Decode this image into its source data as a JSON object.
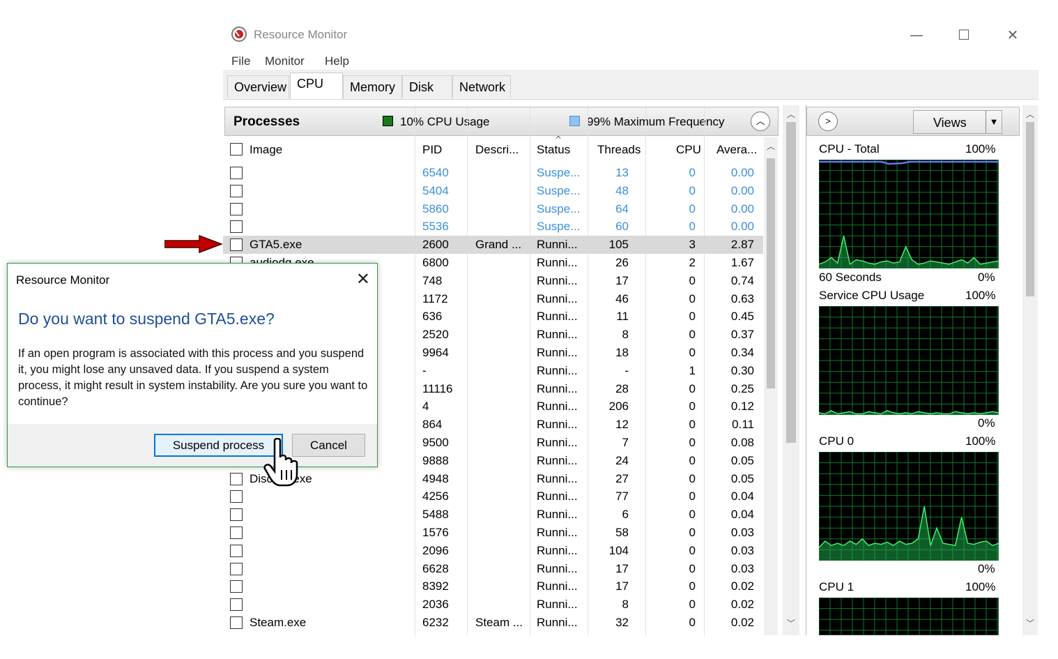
{
  "window": {
    "title": "Resource Monitor",
    "minimize_glyph": "—",
    "maximize_glyph": "☐",
    "close_glyph": "✕"
  },
  "menu": [
    "File",
    "Monitor",
    "Help"
  ],
  "tabs": [
    "Overview",
    "CPU",
    "Memory",
    "Disk",
    "Network"
  ],
  "active_tab": "CPU",
  "processes": {
    "title": "Processes",
    "cpu_usage": "10% CPU Usage",
    "max_frequency": "99% Maximum Frequency",
    "cpu_usage_color": "#1a7a1a",
    "frequency_color": "#8fc2f0",
    "columns": [
      "Image",
      "PID",
      "Descri...",
      "Status",
      "Threads",
      "CPU",
      "Avera..."
    ],
    "rows": [
      {
        "image": "",
        "pid": "6540",
        "desc": "",
        "status": "Suspe...",
        "threads": "13",
        "cpu": "0",
        "avg": "0.00",
        "suspended": true
      },
      {
        "image": "",
        "pid": "5404",
        "desc": "",
        "status": "Suspe...",
        "threads": "48",
        "cpu": "0",
        "avg": "0.00",
        "suspended": true
      },
      {
        "image": "",
        "pid": "5860",
        "desc": "",
        "status": "Suspe...",
        "threads": "64",
        "cpu": "0",
        "avg": "0.00",
        "suspended": true
      },
      {
        "image": "",
        "pid": "5536",
        "desc": "",
        "status": "Suspe...",
        "threads": "60",
        "cpu": "0",
        "avg": "0.00",
        "suspended": true
      },
      {
        "image": "GTA5.exe",
        "pid": "2600",
        "desc": "Grand ...",
        "status": "Runni...",
        "threads": "105",
        "cpu": "3",
        "avg": "2.87",
        "selected": true
      },
      {
        "image": "audiodg.exe",
        "pid": "6800",
        "desc": "",
        "status": "Runni...",
        "threads": "26",
        "cpu": "2",
        "avg": "1.67"
      },
      {
        "image": "",
        "pid": "748",
        "desc": "",
        "status": "Runni...",
        "threads": "17",
        "cpu": "0",
        "avg": "0.74"
      },
      {
        "image": "",
        "pid": "1172",
        "desc": "",
        "status": "Runni...",
        "threads": "46",
        "cpu": "0",
        "avg": "0.63"
      },
      {
        "image": "",
        "pid": "636",
        "desc": "",
        "status": "Runni...",
        "threads": "11",
        "cpu": "0",
        "avg": "0.45"
      },
      {
        "image": "",
        "pid": "2520",
        "desc": "",
        "status": "Runni...",
        "threads": "8",
        "cpu": "0",
        "avg": "0.37"
      },
      {
        "image": "",
        "pid": "9964",
        "desc": "",
        "status": "Runni...",
        "threads": "18",
        "cpu": "0",
        "avg": "0.34"
      },
      {
        "image": "",
        "pid": "-",
        "desc": "",
        "status": "Runni...",
        "threads": "-",
        "cpu": "1",
        "avg": "0.30"
      },
      {
        "image": "",
        "pid": "11116",
        "desc": "",
        "status": "Runni...",
        "threads": "28",
        "cpu": "0",
        "avg": "0.25"
      },
      {
        "image": "",
        "pid": "4",
        "desc": "",
        "status": "Runni...",
        "threads": "206",
        "cpu": "0",
        "avg": "0.12"
      },
      {
        "image": "",
        "pid": "864",
        "desc": "",
        "status": "Runni...",
        "threads": "12",
        "cpu": "0",
        "avg": "0.11"
      },
      {
        "image": "",
        "pid": "9500",
        "desc": "",
        "status": "Runni...",
        "threads": "7",
        "cpu": "0",
        "avg": "0.08"
      },
      {
        "image": "",
        "pid": "9888",
        "desc": "",
        "status": "Runni...",
        "threads": "24",
        "cpu": "0",
        "avg": "0.05"
      },
      {
        "image": "Discord.exe",
        "pid": "4948",
        "desc": "",
        "status": "Runni...",
        "threads": "27",
        "cpu": "0",
        "avg": "0.05"
      },
      {
        "image": "",
        "pid": "4256",
        "desc": "",
        "status": "Runni...",
        "threads": "77",
        "cpu": "0",
        "avg": "0.04"
      },
      {
        "image": "",
        "pid": "5488",
        "desc": "",
        "status": "Runni...",
        "threads": "6",
        "cpu": "0",
        "avg": "0.04"
      },
      {
        "image": "",
        "pid": "1576",
        "desc": "",
        "status": "Runni...",
        "threads": "58",
        "cpu": "0",
        "avg": "0.03"
      },
      {
        "image": "",
        "pid": "2096",
        "desc": "",
        "status": "Runni...",
        "threads": "104",
        "cpu": "0",
        "avg": "0.03"
      },
      {
        "image": "",
        "pid": "6628",
        "desc": "",
        "status": "Runni...",
        "threads": "17",
        "cpu": "0",
        "avg": "0.03"
      },
      {
        "image": "",
        "pid": "8392",
        "desc": "",
        "status": "Runni...",
        "threads": "17",
        "cpu": "0",
        "avg": "0.02"
      },
      {
        "image": "",
        "pid": "2036",
        "desc": "",
        "status": "Runni...",
        "threads": "8",
        "cpu": "0",
        "avg": "0.02"
      },
      {
        "image": "Steam.exe",
        "pid": "6232",
        "desc": "Steam ...",
        "status": "Runni...",
        "threads": "32",
        "cpu": "0",
        "avg": "0.02"
      }
    ]
  },
  "graphs": {
    "views_label": "Views",
    "panels": [
      {
        "label": "CPU - Total",
        "max": "100%",
        "time": "60 Seconds",
        "min": "0%"
      },
      {
        "label": "Service CPU Usage",
        "max": "100%",
        "min": "0%"
      },
      {
        "label": "CPU 0",
        "max": "100%",
        "min": "0%"
      },
      {
        "label": "CPU 1",
        "max": "100%"
      }
    ]
  },
  "dialog": {
    "title": "Resource Monitor",
    "question": "Do you want to suspend GTA5.exe?",
    "body": "If an open program is associated with this process and you suspend it, you might lose any unsaved data. If you suspend a system process, it might result in system instability. Are you sure you want to continue?",
    "primary_button": "Suspend process",
    "secondary_button": "Cancel"
  },
  "annotation_arrow_color": "#c00000"
}
